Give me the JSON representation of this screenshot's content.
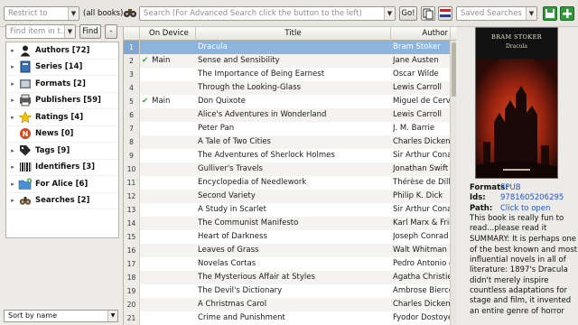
{
  "toolbar": {
    "restrict_placeholder": "Restrict to",
    "all_books_label": "(all books)",
    "search_placeholder": "Search (For Advanced Search click the button to the left)",
    "go_label": "Go!",
    "saved_searches_placeholder": "Saved Searches"
  },
  "sidebar": {
    "find_placeholder": "Find item in t...",
    "find_label": "Find",
    "collapse_label": "-",
    "items": [
      {
        "label": "Authors [72]",
        "icon": "authors-icon",
        "color": "#222222"
      },
      {
        "label": "Series [14]",
        "icon": "series-icon",
        "color": "#3a6fb3"
      },
      {
        "label": "Formats [2]",
        "icon": "formats-icon",
        "color": "#6a7680"
      },
      {
        "label": "Publishers [59]",
        "icon": "publishers-icon",
        "color": "#5a5a5a"
      },
      {
        "label": "Ratings [4]",
        "icon": "star-icon",
        "color": "#f2c200"
      },
      {
        "label": "News [0]",
        "icon": "news-icon",
        "color": "#d9481c"
      },
      {
        "label": "Tags [9]",
        "icon": "tags-icon",
        "color": "#2a2a2a"
      },
      {
        "label": "Identifiers [3]",
        "icon": "barcode-icon",
        "color": "#222222"
      },
      {
        "label": "For Alice [6]",
        "icon": "folder-icon",
        "color": "#4a8fd6"
      },
      {
        "label": "Searches [2]",
        "icon": "binoculars-icon",
        "color": "#6b4a2a"
      }
    ],
    "sort_label": "Sort by name"
  },
  "table": {
    "columns": {
      "device": "On Device",
      "title": "Title",
      "author": "Author"
    },
    "rows": [
      {
        "n": "1",
        "device": "",
        "title": "Dracula",
        "author": "Bram Stoker",
        "selected": true
      },
      {
        "n": "2",
        "device": "Main",
        "title": "Sense and Sensibility",
        "author": "Jane Austen"
      },
      {
        "n": "3",
        "device": "",
        "title": "The Importance of Being Earnest",
        "author": "Oscar Wilde"
      },
      {
        "n": "4",
        "device": "",
        "title": "Through the Looking-Glass",
        "author": "Lewis Carroll"
      },
      {
        "n": "5",
        "device": "Main",
        "title": "Don Quixote",
        "author": "Miguel de Cervantes"
      },
      {
        "n": "6",
        "device": "",
        "title": "Alice's Adventures in Wonderland",
        "author": "Lewis Carroll"
      },
      {
        "n": "7",
        "device": "",
        "title": "Peter Pan",
        "author": "J. M. Barrie"
      },
      {
        "n": "8",
        "device": "",
        "title": "A Tale of Two Cities",
        "author": "Charles Dickens"
      },
      {
        "n": "9",
        "device": "",
        "title": "The Adventures of Sherlock Holmes",
        "author": "Sir Arthur Conan Doyle"
      },
      {
        "n": "10",
        "device": "",
        "title": "Gulliver's Travels",
        "author": "Jonathan Swift"
      },
      {
        "n": "11",
        "device": "",
        "title": "Encyclopedia of Needlework",
        "author": "Thérèse de Dillmont"
      },
      {
        "n": "12",
        "device": "",
        "title": "Second Variety",
        "author": "Philip K. Dick"
      },
      {
        "n": "13",
        "device": "",
        "title": "A Study in Scarlet",
        "author": "Sir Arthur Conan Doyle"
      },
      {
        "n": "14",
        "device": "",
        "title": "The Communist Manifesto",
        "author": "Karl Marx & Friedrich Engels"
      },
      {
        "n": "15",
        "device": "",
        "title": "Heart of Darkness",
        "author": "Joseph Conrad"
      },
      {
        "n": "16",
        "device": "",
        "title": "Leaves of Grass",
        "author": "Walt Whitman"
      },
      {
        "n": "17",
        "device": "",
        "title": "Novelas Cortas",
        "author": "Pedro Antonio de Alarcón"
      },
      {
        "n": "18",
        "device": "",
        "title": "The Mysterious Affair at Styles",
        "author": "Agatha Christie"
      },
      {
        "n": "19",
        "device": "",
        "title": "The Devil's Dictionary",
        "author": "Ambrose Bierce"
      },
      {
        "n": "20",
        "device": "",
        "title": "A Christmas Carol",
        "author": "Charles Dickens"
      },
      {
        "n": "21",
        "device": "",
        "title": "Crime and Punishment",
        "author": "Fyodor Dostoyevsky"
      }
    ]
  },
  "detail": {
    "cover_author": "BRAM STOKER",
    "cover_title": "Dracula",
    "formats_key": "Formats:",
    "formats_val": "EPUB",
    "ids_key": "Ids:",
    "ids_val": "9781605206295",
    "path_key": "Path:",
    "path_val": "Click to open",
    "comment": "This book is really fun to read...please read it",
    "summary": "SUMMARY: It is perhaps one of the best known and most influential novels in all of literature: 1897's Dracula didn't merely inspire countless adaptations for stage and film, it invented an entire genre of horror"
  },
  "colors": {
    "selection": "#8cb4dd",
    "check": "#3b9a3b",
    "link": "#2255cc"
  }
}
